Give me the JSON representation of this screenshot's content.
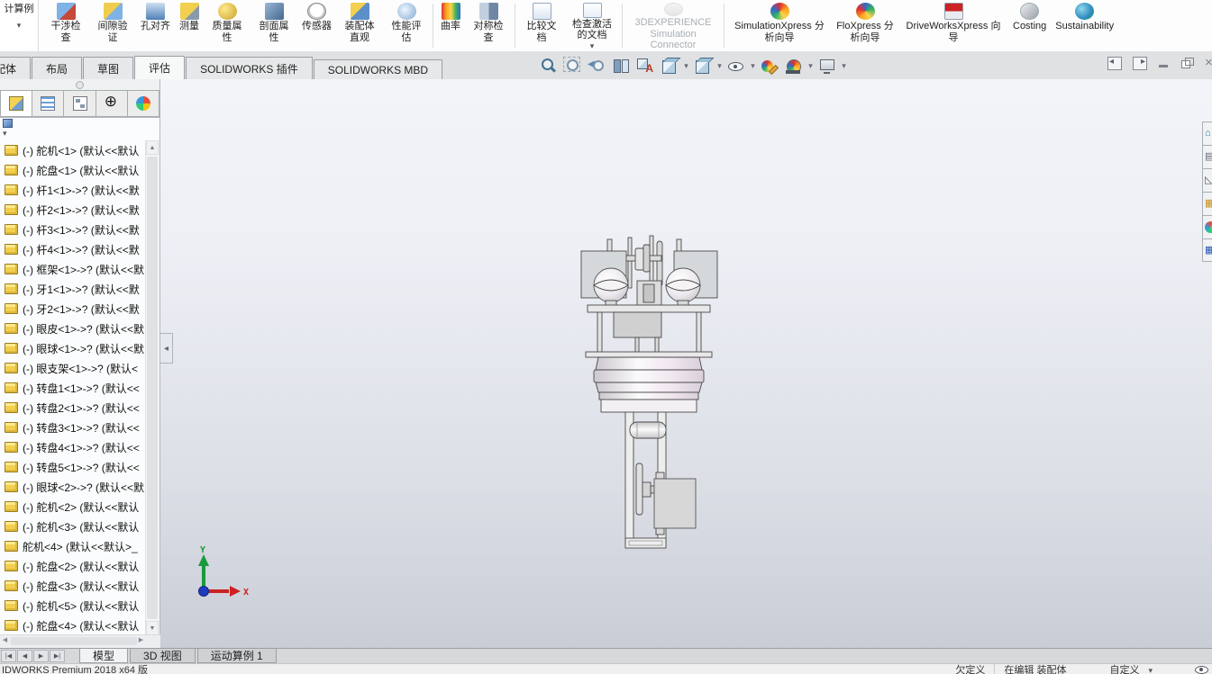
{
  "ribbon": {
    "partial_tool": {
      "label": "计算例",
      "icon": "motion-study-calc",
      "dropdown": true
    },
    "tools": [
      {
        "label": "干涉检查",
        "icon": "interference"
      },
      {
        "label": "间隙验证",
        "icon": "clearance"
      },
      {
        "label": "孔对齐",
        "icon": "hole-alignment"
      },
      {
        "label": "测量",
        "icon": "measure"
      },
      {
        "label": "质量属性",
        "icon": "mass-properties"
      },
      {
        "label": "剖面属性",
        "icon": "section-properties"
      },
      {
        "label": "传感器",
        "icon": "sensors"
      },
      {
        "label": "装配体直观",
        "icon": "assembly-visualization"
      },
      {
        "label": "性能评估",
        "icon": "performance-evaluation",
        "sep_after": true
      },
      {
        "label": "曲率",
        "icon": "curvature"
      },
      {
        "label": "对称检查",
        "icon": "symmetry-check",
        "sep_after": true
      },
      {
        "label": "比较文档",
        "icon": "compare-documents"
      },
      {
        "label": "检查激活的文档",
        "icon": "check-active-document",
        "dropdown": true,
        "sep_after": true
      },
      {
        "label": "3DEXPERIENCE Simulation Connector",
        "icon": "3dexperience-connector",
        "disabled": true,
        "sep_after": true
      },
      {
        "label": "SimulationXpress 分析向导",
        "icon": "simulationxpress"
      },
      {
        "label": "FloXpress 分析向导",
        "icon": "floxpress"
      },
      {
        "label": "DriveWorksXpress 向导",
        "icon": "driveworksxpress"
      },
      {
        "label": "Costing",
        "icon": "costing"
      },
      {
        "label": "Sustainability",
        "icon": "sustainability"
      }
    ]
  },
  "command_tabs": {
    "items": [
      {
        "label": "配体",
        "clipped": true
      },
      {
        "label": "布局"
      },
      {
        "label": "草图"
      },
      {
        "label": "评估",
        "active": true
      },
      {
        "label": "SOLIDWORKS 插件"
      },
      {
        "label": "SOLIDWORKS MBD"
      }
    ]
  },
  "view_toolbar": {
    "icons": [
      {
        "name": "zoom-fit"
      },
      {
        "name": "zoom-area"
      },
      {
        "name": "previous-view"
      },
      {
        "name": "section-view"
      },
      {
        "name": "annotations"
      },
      {
        "name": "view-orientation",
        "dropdown": true
      },
      {
        "name": "display-style",
        "dropdown": true
      },
      {
        "name": "hide-show-items",
        "dropdown": true
      },
      {
        "name": "edit-appearance"
      },
      {
        "name": "apply-scene",
        "dropdown": true
      },
      {
        "name": "view-settings",
        "dropdown": true
      }
    ]
  },
  "window_controls": [
    {
      "name": "pane-left"
    },
    {
      "name": "pane-right"
    },
    {
      "name": "minimize"
    },
    {
      "name": "restore"
    },
    {
      "name": "close"
    }
  ],
  "panel_tabs": [
    {
      "name": "featuremanager",
      "active": true
    },
    {
      "name": "propertymanager"
    },
    {
      "name": "configurationmanager"
    },
    {
      "name": "dimxpertmanager"
    },
    {
      "name": "displaymanager"
    }
  ],
  "feature_tree": {
    "items": [
      {
        "text": "(-) 舵机<1> (默认<<默认"
      },
      {
        "text": "(-) 舵盘<1> (默认<<默认"
      },
      {
        "text": "(-) 杆1<1>->? (默认<<默"
      },
      {
        "text": "(-) 杆2<1>->? (默认<<默"
      },
      {
        "text": "(-) 杆3<1>->? (默认<<默"
      },
      {
        "text": "(-) 杆4<1>->? (默认<<默"
      },
      {
        "text": "(-) 框架<1>->? (默认<<默"
      },
      {
        "text": "(-) 牙1<1>->? (默认<<默"
      },
      {
        "text": "(-) 牙2<1>->? (默认<<默"
      },
      {
        "text": "(-) 眼皮<1>->? (默认<<默"
      },
      {
        "text": "(-) 眼球<1>->? (默认<<默"
      },
      {
        "text": "(-) 眼支架<1>->? (默认<"
      },
      {
        "text": "(-) 转盘1<1>->? (默认<<"
      },
      {
        "text": "(-) 转盘2<1>->? (默认<<"
      },
      {
        "text": "(-) 转盘3<1>->? (默认<<"
      },
      {
        "text": "(-) 转盘4<1>->? (默认<<"
      },
      {
        "text": "(-) 转盘5<1>->? (默认<<"
      },
      {
        "text": "(-) 眼球<2>->? (默认<<默"
      },
      {
        "text": "(-) 舵机<2> (默认<<默认"
      },
      {
        "text": "(-) 舵机<3> (默认<<默认"
      },
      {
        "text": "舵机<4> (默认<<默认>_"
      },
      {
        "text": "(-) 舵盘<2> (默认<<默认"
      },
      {
        "text": "(-) 舵盘<3> (默认<<默认"
      },
      {
        "text": "(-) 舵机<5> (默认<<默认"
      },
      {
        "text": "(-) 舵盘<4> (默认<<默认"
      }
    ]
  },
  "task_pane": {
    "icons": [
      {
        "name": "solidworks-resources"
      },
      {
        "name": "design-library"
      },
      {
        "name": "file-explorer"
      },
      {
        "name": "view-palette"
      },
      {
        "name": "appearances-scenes"
      },
      {
        "name": "custom-properties"
      }
    ]
  },
  "triad": {
    "x_label": "X",
    "y_label": "Y",
    "x_color": "#cc2222",
    "y_color": "#1a9a3c",
    "z_color": "#1f3bbf"
  },
  "document_tabs": {
    "items": [
      {
        "label": "模型",
        "active": true
      },
      {
        "label": "3D 视图"
      },
      {
        "label": "运动算例 1"
      }
    ]
  },
  "status_bar": {
    "app_version": "IDWORKS Premium 2018 x64 版",
    "define_state": "欠定义",
    "edit_state": "在编辑 装配体",
    "custom_label": "自定义"
  }
}
